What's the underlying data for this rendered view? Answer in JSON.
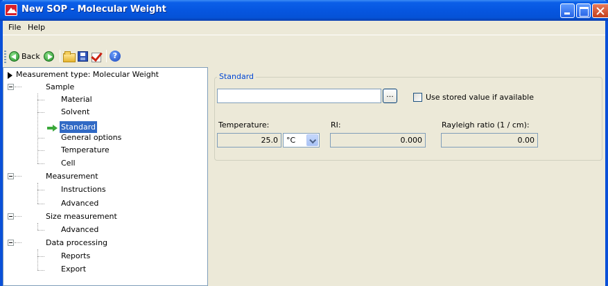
{
  "window": {
    "title": "New SOP - Molecular Weight"
  },
  "menu": {
    "items": [
      {
        "label": "File"
      },
      {
        "label": "Help"
      }
    ]
  },
  "toolbar": {
    "back_label": "Back"
  },
  "tree": {
    "root": "Measurement type: Molecular Weight",
    "groups": [
      {
        "label": "Sample",
        "children": [
          "Material",
          "Solvent",
          "Standard",
          "General options",
          "Temperature",
          "Cell"
        ]
      },
      {
        "label": "Measurement",
        "children": [
          "Instructions",
          "Advanced"
        ]
      },
      {
        "label": "Size measurement",
        "children": [
          "Advanced"
        ]
      },
      {
        "label": "Data processing",
        "children": [
          "Reports",
          "Export"
        ]
      }
    ],
    "selected": "Standard"
  },
  "standard_panel": {
    "title": "Standard",
    "standard_value": "",
    "browse_label": "...",
    "use_stored_label": "Use stored value if available",
    "temperature_label": "Temperature:",
    "temperature_value": "25.0",
    "temperature_unit": "°C",
    "ri_label": "RI:",
    "ri_value": "0.000",
    "rayleigh_label": "Rayleigh ratio (1 / cm):",
    "rayleigh_value": "0.00"
  },
  "colors": {
    "title_bar": "#0656e0",
    "selection": "#316ac5",
    "group_title": "#0046d5"
  }
}
